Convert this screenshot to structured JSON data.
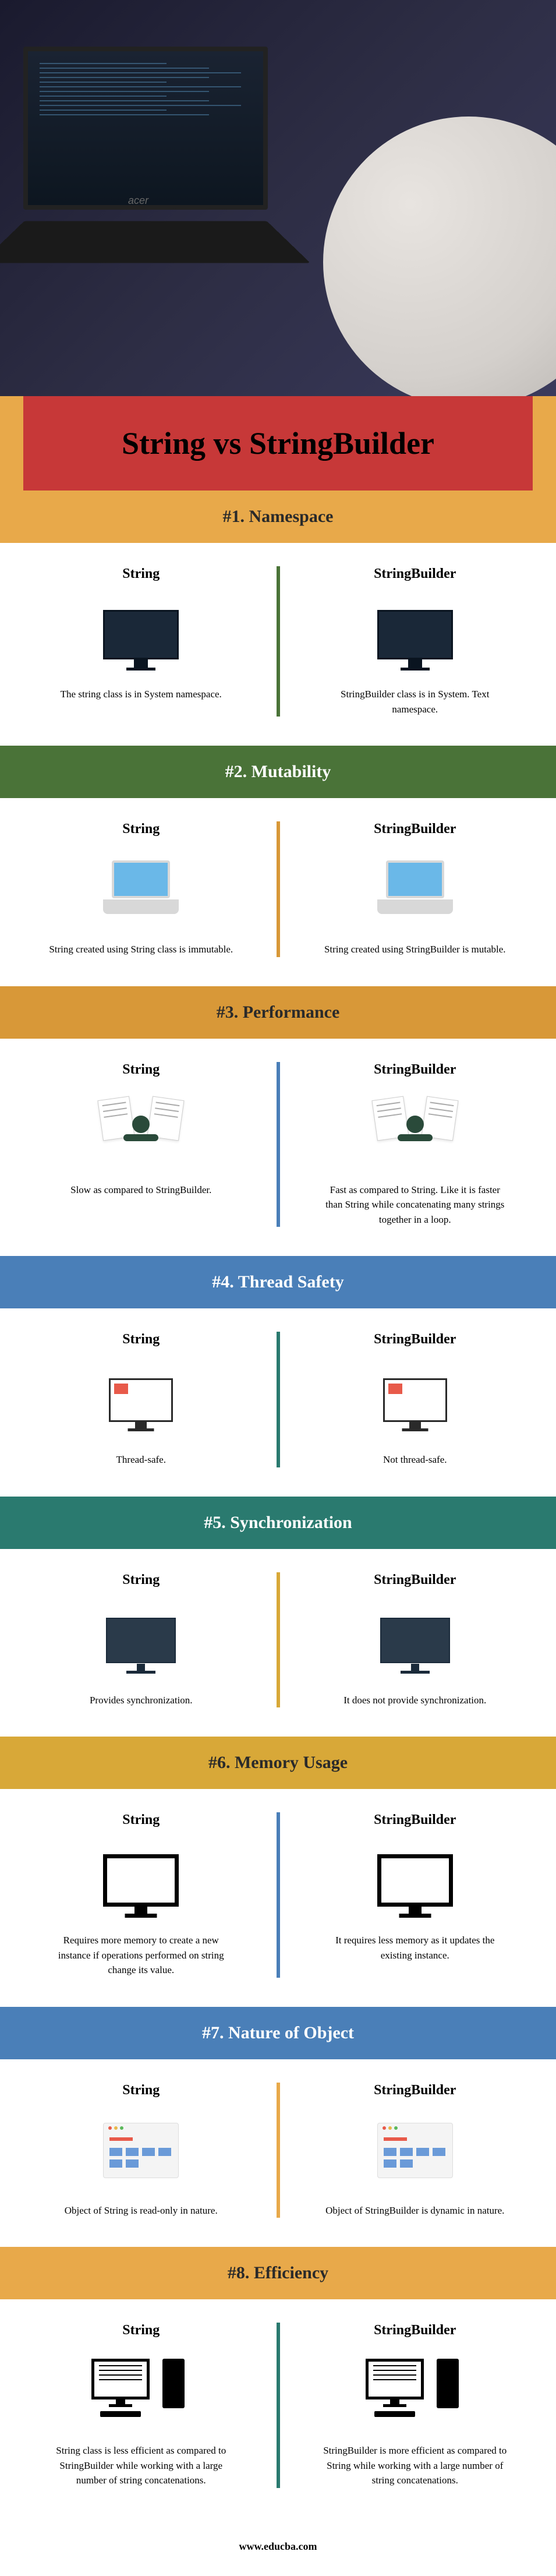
{
  "title": "String vs StringBuilder",
  "footer": "www.educba.com",
  "sections": [
    {
      "num": "#1.",
      "name": "Namespace",
      "colL": "String",
      "colR": "StringBuilder",
      "textL": "The string class is in System namespace.",
      "textR": "StringBuilder class is in System. Text namespace."
    },
    {
      "num": "#2.",
      "name": "Mutability",
      "colL": "String",
      "colR": "StringBuilder",
      "textL": "String created using String class is immutable.",
      "textR": "String created using StringBuilder is mutable."
    },
    {
      "num": "#3.",
      "name": "Performance",
      "colL": "String",
      "colR": "StringBuilder",
      "textL": "Slow as compared to StringBuilder.",
      "textR": "Fast as compared to String. Like it is faster than String while concatenating many strings together in a loop."
    },
    {
      "num": "#4.",
      "name": "Thread Safety",
      "colL": "String",
      "colR": "StringBuilder",
      "textL": "Thread-safe.",
      "textR": "Not thread-safe."
    },
    {
      "num": "#5.",
      "name": "Synchronization",
      "colL": "String",
      "colR": "StringBuilder",
      "textL": "Provides synchronization.",
      "textR": "It does not provide synchronization."
    },
    {
      "num": "#6.",
      "name": "Memory Usage",
      "colL": "String",
      "colR": "StringBuilder",
      "textL": "Requires more memory to create a new instance if operations performed on string change its value.",
      "textR": "It requires less memory as it updates the existing instance."
    },
    {
      "num": "#7.",
      "name": "Nature of Object",
      "colL": "String",
      "colR": "StringBuilder",
      "textL": "Object of String is read-only in nature.",
      "textR": "Object of StringBuilder is dynamic in nature."
    },
    {
      "num": "#8.",
      "name": "Efficiency",
      "colL": "String",
      "colR": "StringBuilder",
      "textL": "String class is less efficient as compared to StringBuilder while working with a large number of string concatenations.",
      "textR": "StringBuilder is more efficient as compared to String while working with a large number of string concatenations."
    }
  ]
}
